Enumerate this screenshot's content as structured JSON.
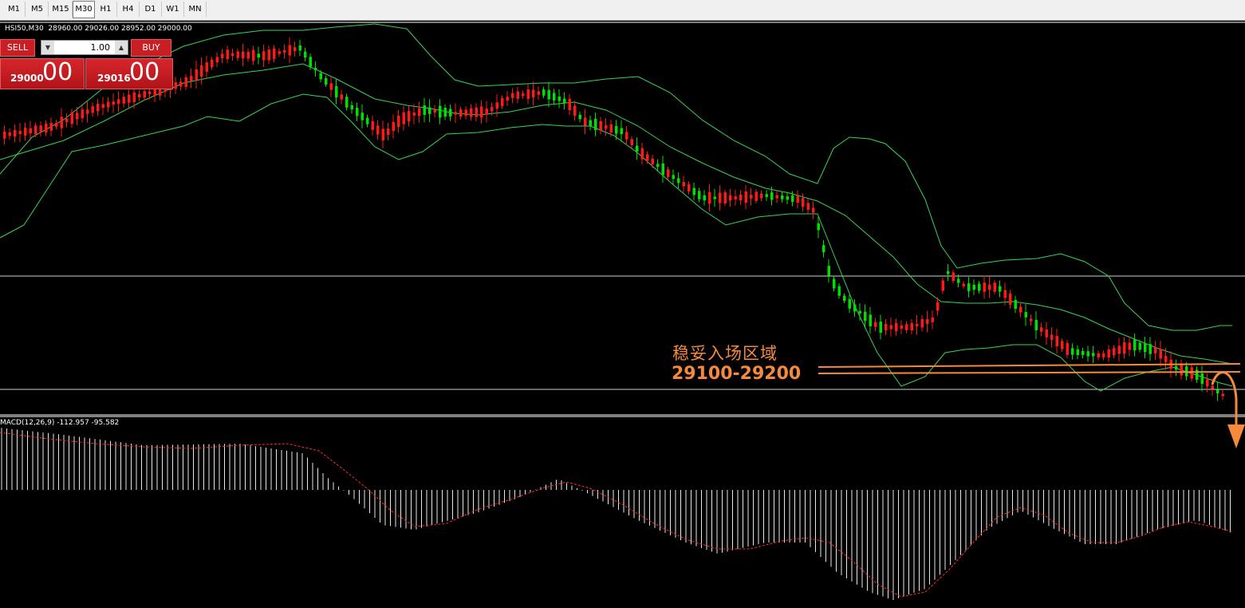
{
  "toolbar": {
    "timeframes": [
      "M1",
      "M5",
      "M15",
      "M30",
      "H1",
      "H4",
      "D1",
      "W1",
      "MN"
    ],
    "active": "M30"
  },
  "symbol_info": "HSI50,M30  28960.00 29026.00 28952.00 29000.00",
  "trade_panel": {
    "sell_label": "SELL",
    "buy_label": "BUY",
    "lot": "1.00",
    "sell_price_small": "29000",
    "sell_price_big": "00",
    "buy_price_small": "29016",
    "buy_price_big": "00"
  },
  "annotation": {
    "zone_label": "稳妥入场区域",
    "zone_range": "29100-29200",
    "color": "#f58a3c"
  },
  "macd": {
    "label": "MACD(12,26,9) -112.957 -95.582"
  },
  "colors": {
    "bull": "#ff1a1a",
    "bear": "#00e000",
    "band": "#39d353",
    "signal": "#ff2a2a"
  },
  "chart_data": {
    "type": "candlestick",
    "symbol": "HSI50",
    "timeframe": "M30",
    "indicators": [
      "Bollinger Bands",
      "MACD(12,26,9)"
    ],
    "entry_zone": [
      29100,
      29200
    ],
    "macd_values": {
      "macd": -112.957,
      "signal": -95.582
    }
  }
}
